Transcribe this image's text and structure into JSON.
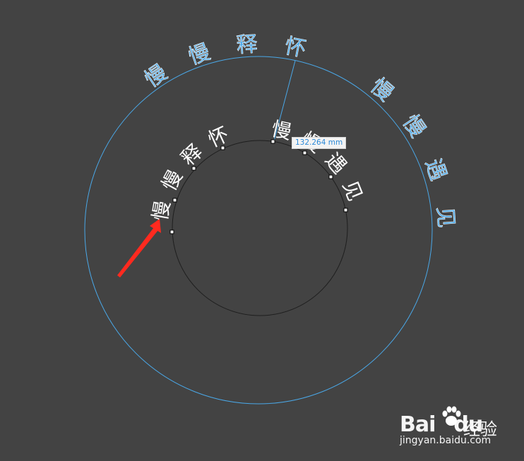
{
  "outer_text": {
    "chars": [
      "慢",
      "慢",
      "释",
      "怀",
      "",
      "慢",
      "慢",
      "遇",
      "见"
    ],
    "color": "#4aa8e8",
    "outline": "#ffffff"
  },
  "inner_text": {
    "chars": [
      "慢",
      "慢",
      "释",
      "怀",
      "",
      "慢",
      "慢",
      "遇",
      "见"
    ],
    "color": "#ffffff"
  },
  "measure": {
    "label": "132.264 mm",
    "color": "#2d8ad8"
  },
  "colors": {
    "background": "#434343",
    "outer_path": "#4aa8e8",
    "inner_path": "#222222",
    "arrow": "#ff2a1f"
  },
  "watermark": {
    "brand_prefix": "Bai",
    "brand_suffix": "du",
    "brand_cn": "经验",
    "url": "jingyan.baidu.com",
    "icon": "paw-icon"
  }
}
